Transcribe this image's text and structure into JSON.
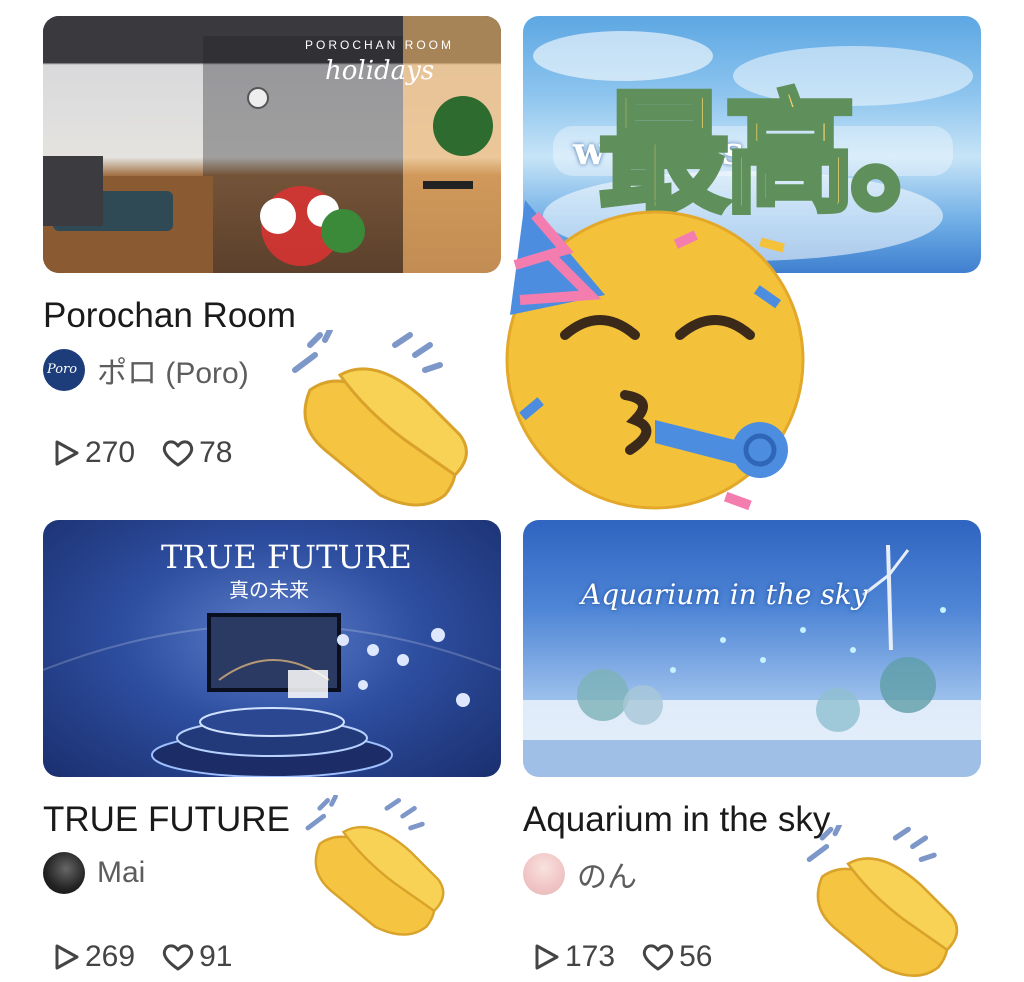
{
  "cards": [
    {
      "title": "Porochan Room",
      "author": "ポロ (Poro)",
      "plays": "270",
      "likes": "78",
      "thumb_top": "POROCHAN ROOM",
      "thumb_script": "holidays",
      "avatar_text": "Poro"
    },
    {
      "title": "",
      "author": "",
      "plays": "",
      "likes": "",
      "thumb_text": "w sk ats",
      "overlay_text": "最高。"
    },
    {
      "title": "TRUE FUTURE",
      "author": "Mai",
      "plays": "269",
      "likes": "91",
      "thumb_title": "TRUE FUTURE",
      "thumb_sub": "真の未来"
    },
    {
      "title": "Aquarium in the sky",
      "author": "のん",
      "plays": "173",
      "likes": "56",
      "thumb_title": "Aquarium in the sky"
    }
  ],
  "icons": {
    "play": "play-icon",
    "like": "heart-icon"
  },
  "colors": {
    "title": "#1a1a1a",
    "meta": "#5d5d5d",
    "sticker_text": "#f4d36a",
    "sticker_outline": "#5f8f5a"
  }
}
